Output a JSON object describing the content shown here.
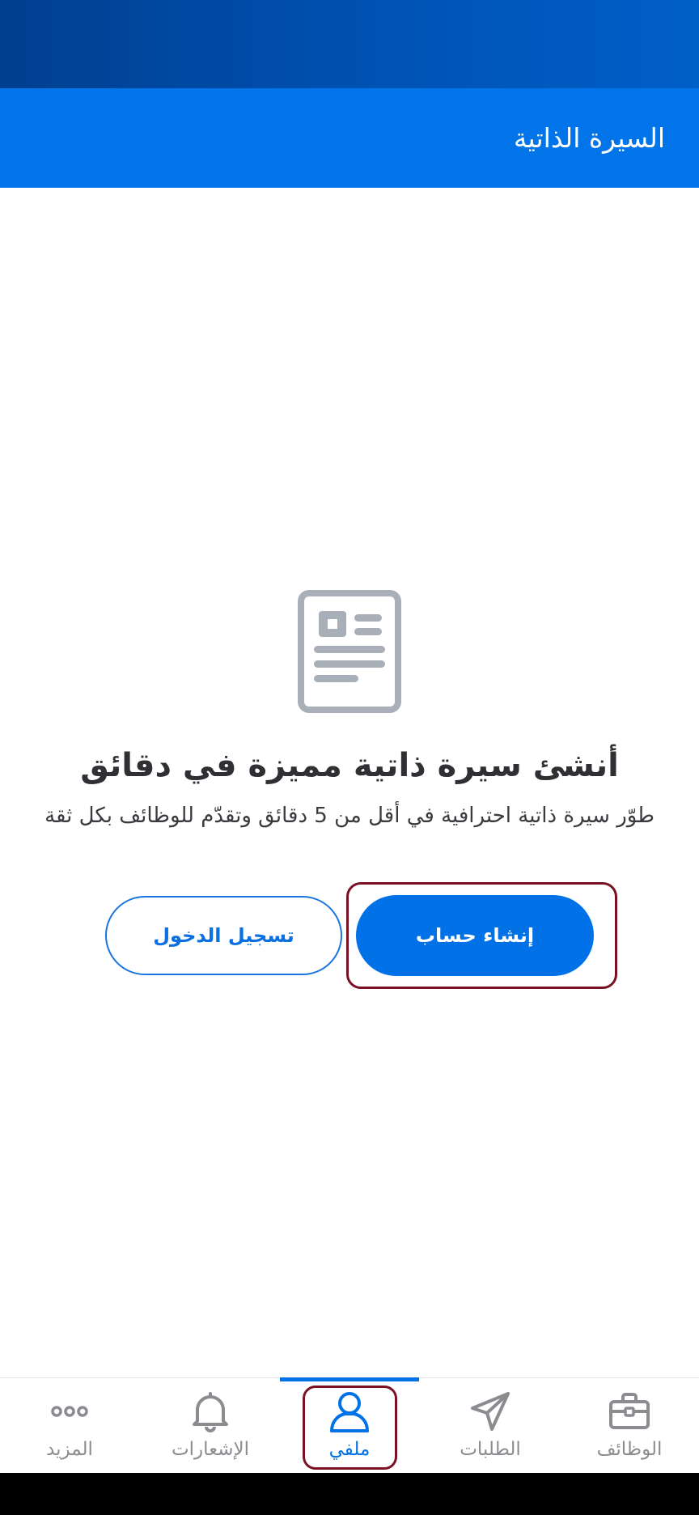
{
  "header": {
    "title": "السيرة الذاتية"
  },
  "empty_state": {
    "icon": "resume-document-icon",
    "headline": "أنشئ سيرة ذاتية مميزة في دقائق",
    "subtext": "طوّر سيرة ذاتية احترافية في أقل من 5 دقائق وتقدّم للوظائف بكل ثقة",
    "primary_button": "إنشاء حساب",
    "secondary_button": "تسجيل الدخول"
  },
  "bottom_nav": {
    "active_tab": "ملفي",
    "items": [
      {
        "label": "الوظائف",
        "icon": "briefcase-icon"
      },
      {
        "label": "الطلبات",
        "icon": "paper-plane-icon"
      },
      {
        "label": "ملفي",
        "icon": "user-icon"
      },
      {
        "label": "الإشعارات",
        "icon": "bell-icon"
      },
      {
        "label": "المزيد",
        "icon": "more-dots-icon"
      }
    ]
  },
  "colors": {
    "primary": "#0071e6",
    "header": "#0074e8",
    "status_bar": "#0052b4",
    "highlight": "#7a1024",
    "icon_gray": "#a8afb9",
    "nav_inactive": "#8a8c90"
  }
}
